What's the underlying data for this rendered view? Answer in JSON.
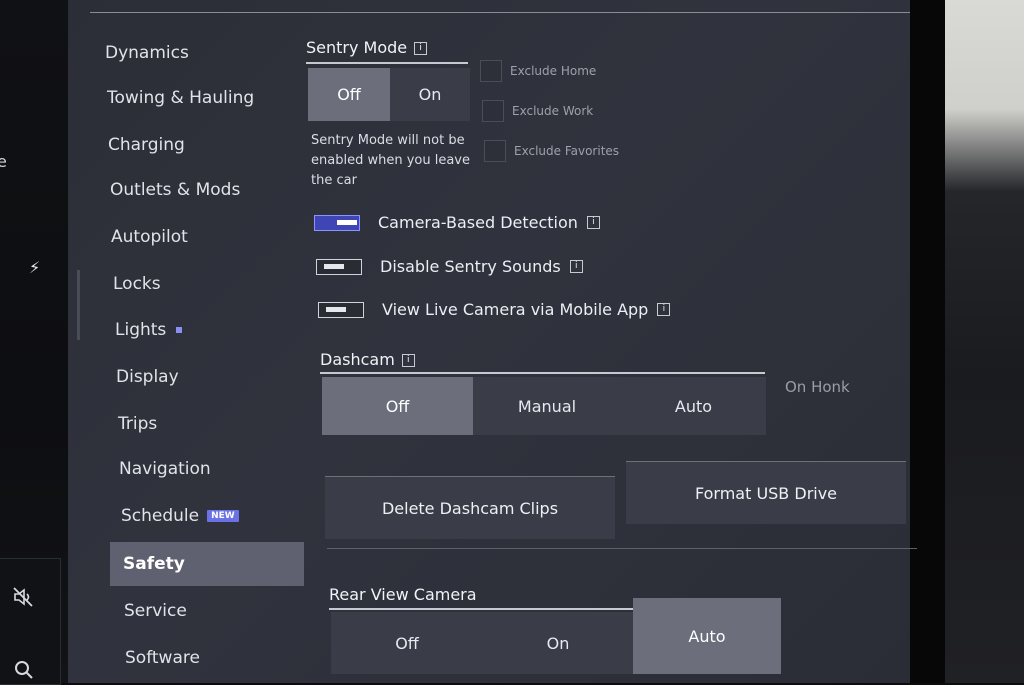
{
  "left_strip": {
    "cut_text": "e",
    "icons": [
      "bolt-icon",
      "mute-icon",
      "search-icon"
    ]
  },
  "sidebar": {
    "items": [
      {
        "label": "Dynamics"
      },
      {
        "label": "Towing & Hauling"
      },
      {
        "label": "Charging"
      },
      {
        "label": "Outlets & Mods"
      },
      {
        "label": "Autopilot"
      },
      {
        "label": "Locks"
      },
      {
        "label": "Lights"
      },
      {
        "label": "Display"
      },
      {
        "label": "Trips"
      },
      {
        "label": "Navigation"
      },
      {
        "label": "Schedule",
        "badge": "NEW"
      },
      {
        "label": "Safety",
        "active": true
      },
      {
        "label": "Service"
      },
      {
        "label": "Software"
      }
    ]
  },
  "sentry": {
    "title": "Sentry Mode",
    "info_glyph": "i",
    "options": [
      "Off",
      "On"
    ],
    "selected": "Off",
    "description": "Sentry Mode will not be enabled when you leave the car",
    "excludes": [
      "Exclude Home",
      "Exclude Work",
      "Exclude Favorites"
    ]
  },
  "toggles": [
    {
      "label": "Camera-Based Detection",
      "on": true
    },
    {
      "label": "Disable Sentry Sounds",
      "on": false
    },
    {
      "label": "View Live Camera via Mobile App",
      "on": false
    }
  ],
  "dashcam": {
    "title": "Dashcam",
    "options": [
      "Off",
      "Manual",
      "Auto"
    ],
    "selected": "Off",
    "on_honk": "On Honk",
    "delete_button": "Delete Dashcam Clips",
    "format_button": "Format USB Drive"
  },
  "rear_camera": {
    "title": "Rear View Camera",
    "options": [
      "Off",
      "On",
      "Auto"
    ],
    "selected": "Auto"
  },
  "colors": {
    "accent": "#6a72e6",
    "selected_segment": "#6c6e7c",
    "panel": "#2e3039"
  }
}
